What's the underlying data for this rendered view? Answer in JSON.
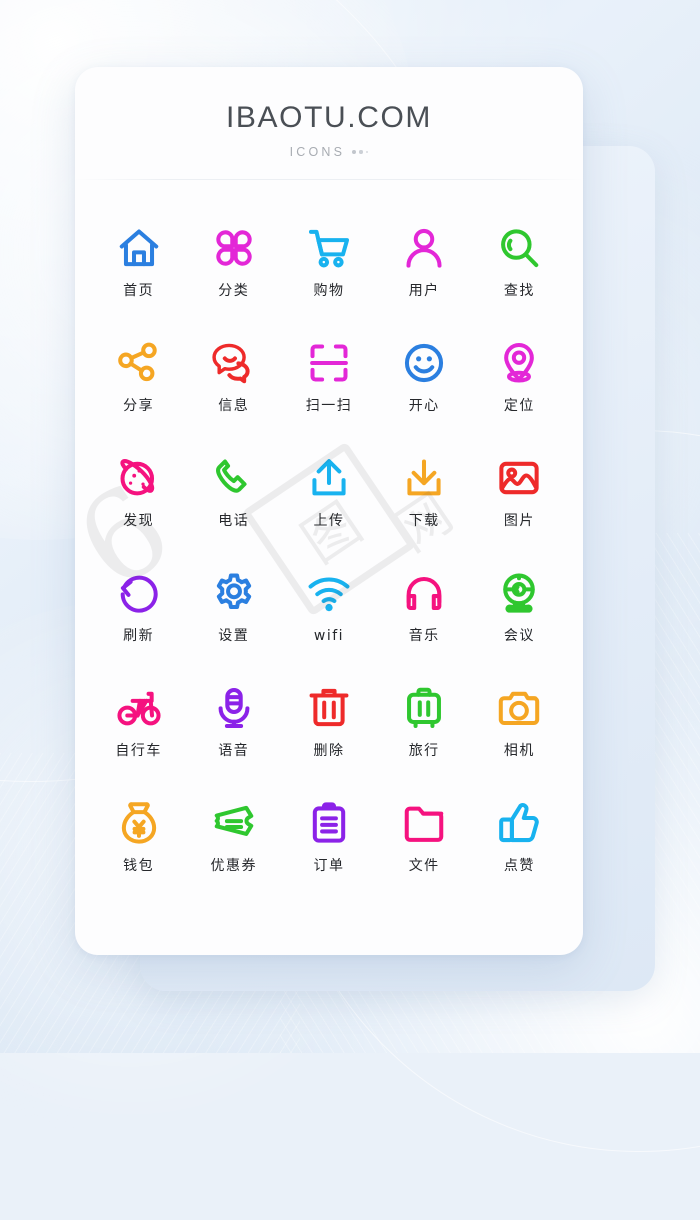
{
  "header": {
    "brand": "IBAOTU.COM",
    "subtitle": "ICONS",
    "dots_count": 3
  },
  "watermark": {
    "numeral": "6",
    "box_char": "图",
    "text": "网"
  },
  "palette": {
    "blue": "#2b7fe0",
    "magenta": "#e327d7",
    "cyan": "#18b2ef",
    "green": "#2fc72f",
    "orange": "#f5a623",
    "red": "#ee2a2a",
    "pink": "#f5127f",
    "purple": "#8b22e8",
    "label": "#26282c",
    "card": "#fdfdfe"
  },
  "grid": {
    "columns": 5,
    "rows": 6,
    "icons": [
      {
        "label": "首页",
        "icon": "home-icon",
        "color": "#2b7fe0"
      },
      {
        "label": "分类",
        "icon": "clover-icon",
        "color": "#e327d7"
      },
      {
        "label": "购物",
        "icon": "cart-icon",
        "color": "#18b2ef"
      },
      {
        "label": "用户",
        "icon": "user-icon",
        "color": "#e327d7"
      },
      {
        "label": "查找",
        "icon": "search-icon",
        "color": "#2fc72f"
      },
      {
        "label": "分享",
        "icon": "share-icon",
        "color": "#f5a623"
      },
      {
        "label": "信息",
        "icon": "message-icon",
        "color": "#ee2a2a"
      },
      {
        "label": "扫一扫",
        "icon": "scan-icon",
        "color": "#e327d7"
      },
      {
        "label": "开心",
        "icon": "smiley-icon",
        "color": "#2b7fe0"
      },
      {
        "label": "定位",
        "icon": "location-icon",
        "color": "#e327d7"
      },
      {
        "label": "发现",
        "icon": "planet-icon",
        "color": "#f5127f"
      },
      {
        "label": "电话",
        "icon": "phone-icon",
        "color": "#2fc72f"
      },
      {
        "label": "上传",
        "icon": "upload-icon",
        "color": "#18b2ef"
      },
      {
        "label": "下载",
        "icon": "download-icon",
        "color": "#f5a623"
      },
      {
        "label": "图片",
        "icon": "image-icon",
        "color": "#ee2a2a"
      },
      {
        "label": "刷新",
        "icon": "refresh-icon",
        "color": "#8b22e8"
      },
      {
        "label": "设置",
        "icon": "gear-icon",
        "color": "#2b7fe0"
      },
      {
        "label": "wifi",
        "icon": "wifi-icon",
        "color": "#18b2ef"
      },
      {
        "label": "音乐",
        "icon": "headphones-icon",
        "color": "#f5127f"
      },
      {
        "label": "会议",
        "icon": "webcam-icon",
        "color": "#2fc72f"
      },
      {
        "label": "自行车",
        "icon": "bicycle-icon",
        "color": "#f5127f"
      },
      {
        "label": "语音",
        "icon": "microphone-icon",
        "color": "#8b22e8"
      },
      {
        "label": "删除",
        "icon": "trash-icon",
        "color": "#ee2a2a"
      },
      {
        "label": "旅行",
        "icon": "suitcase-icon",
        "color": "#2fc72f"
      },
      {
        "label": "相机",
        "icon": "camera-icon",
        "color": "#f5a623"
      },
      {
        "label": "钱包",
        "icon": "money-bag-icon",
        "color": "#f5a623"
      },
      {
        "label": "优惠券",
        "icon": "coupon-icon",
        "color": "#2fc72f"
      },
      {
        "label": "订单",
        "icon": "clipboard-icon",
        "color": "#8b22e8"
      },
      {
        "label": "文件",
        "icon": "folder-icon",
        "color": "#f5127f"
      },
      {
        "label": "点赞",
        "icon": "thumbs-up-icon",
        "color": "#18b2ef"
      }
    ]
  }
}
